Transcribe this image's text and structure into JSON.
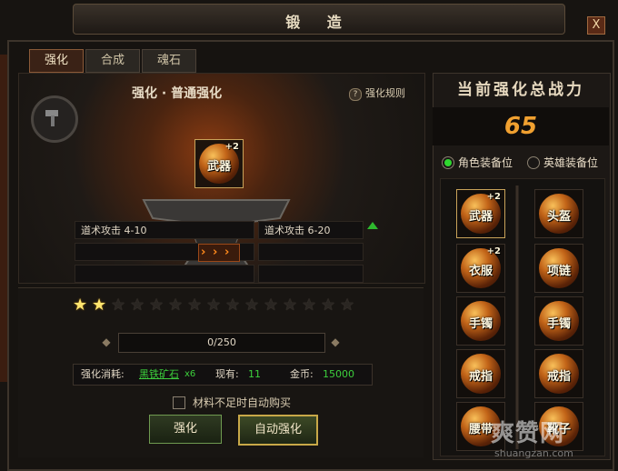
{
  "window": {
    "title": "锻 造",
    "close_label": "X"
  },
  "tabs": [
    {
      "label": "强化"
    },
    {
      "label": "合成"
    },
    {
      "label": "魂石"
    }
  ],
  "enhance": {
    "subtitle": "强化 · 普通强化",
    "rule_label": "强化规则",
    "item": {
      "label": "武器",
      "level": "+2"
    },
    "stats_before": [
      "道术攻击 4-10"
    ],
    "stats_after": [
      "道术攻击 6-20"
    ],
    "stars": {
      "filled": 2,
      "total": 15
    },
    "progress_text": "0/250",
    "cost_label": "强化消耗:",
    "cost_item": "黑铁矿石",
    "cost_qty": "x6",
    "owned_label": "现有:",
    "owned_value": "11",
    "gold_label": "金币:",
    "gold_value": "15000",
    "autobuy_label": "材料不足时自动购买",
    "buttons": {
      "enhance": "强化",
      "auto_enhance": "自动强化"
    }
  },
  "power": {
    "title": "当前强化总战力",
    "value": "65"
  },
  "equip_tabs": [
    {
      "label": "角色装备位",
      "selected": true
    },
    {
      "label": "英雄装备位",
      "selected": false
    }
  ],
  "equip_slots_left": [
    {
      "label": "武器",
      "level": "+2",
      "selected": true
    },
    {
      "label": "衣服",
      "level": "+2",
      "selected": false
    },
    {
      "label": "手镯",
      "level": "",
      "selected": false
    },
    {
      "label": "戒指",
      "level": "",
      "selected": false
    },
    {
      "label": "腰带",
      "level": "",
      "selected": false
    }
  ],
  "equip_slots_right": [
    {
      "label": "头盔",
      "level": ""
    },
    {
      "label": "项链",
      "level": ""
    },
    {
      "label": "手镯",
      "level": ""
    },
    {
      "label": "戒指",
      "level": ""
    },
    {
      "label": "靴子",
      "level": ""
    }
  ],
  "watermark": {
    "text": "爽赞网",
    "url": "shuangzan.com"
  },
  "colors": {
    "accent": "#f0a030",
    "gold_border": "#c9a35a",
    "green": "#2fd82f",
    "cost_item": "#3ccf3c"
  }
}
